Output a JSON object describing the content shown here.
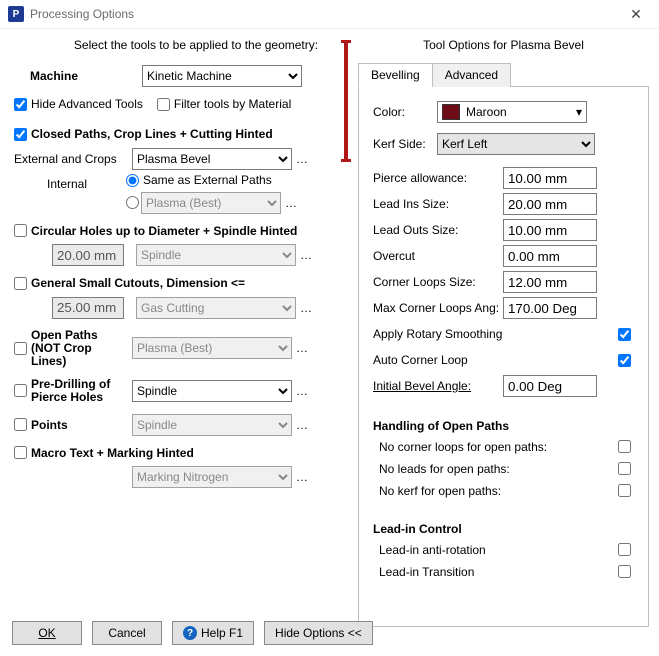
{
  "title": "Processing Options",
  "instruction": "Select the tools to be applied to the geometry:",
  "machine": {
    "label": "Machine",
    "value": "Kinetic Machine"
  },
  "hide_advanced": {
    "label": "Hide Advanced Tools",
    "checked": true
  },
  "filter_material": {
    "label": "Filter tools by Material",
    "checked": false
  },
  "closed_paths": {
    "label": "Closed Paths,  Crop Lines  +  Cutting Hinted",
    "checked": true
  },
  "external": {
    "label": "External and Crops",
    "value": "Plasma Bevel"
  },
  "internal": {
    "label": "Internal",
    "same_label": "Same as External Paths",
    "value": "Plasma (Best)",
    "mode": "same"
  },
  "circular": {
    "label": "Circular Holes up to Diameter   +  Spindle Hinted",
    "checked": false,
    "dim": "20.00 mm",
    "tool": "Spindle"
  },
  "small_cut": {
    "label": "General Small Cutouts, Dimension <=",
    "checked": false,
    "dim": "25.00 mm",
    "tool": "Gas Cutting"
  },
  "open_paths": {
    "label": "Open Paths (NOT Crop Lines)",
    "checked": false,
    "tool": "Plasma (Best)"
  },
  "predrill": {
    "label": "Pre-Drilling of Pierce Holes",
    "checked": false,
    "tool": "Spindle"
  },
  "points": {
    "label": "Points",
    "checked": false,
    "tool": "Spindle"
  },
  "macro": {
    "label": "Macro Text   +  Marking Hinted",
    "checked": false,
    "tool": "Marking Nitrogen"
  },
  "right": {
    "header": "Tool Options for Plasma Bevel",
    "tabs": {
      "bevelling": "Bevelling",
      "advanced": "Advanced"
    },
    "color": {
      "label": "Color:",
      "name": "Maroon",
      "hex": "#6e0b14"
    },
    "kerf": {
      "label": "Kerf Side:",
      "value": "Kerf Left"
    },
    "pierce": {
      "label": "Pierce allowance:",
      "value": "10.00 mm"
    },
    "leadin": {
      "label": "Lead Ins Size:",
      "value": "20.00 mm"
    },
    "leadout": {
      "label": "Lead Outs Size:",
      "value": "10.00 mm"
    },
    "overcut": {
      "label": "Overcut",
      "value": "0.00 mm"
    },
    "corner": {
      "label": "Corner Loops Size:",
      "value": "12.00 mm"
    },
    "maxcorner": {
      "label": "Max Corner Loops Ang:",
      "value": "170.00 Deg"
    },
    "rotary": {
      "label": "Apply Rotary Smoothing",
      "checked": true
    },
    "autocorner": {
      "label": "Auto Corner Loop",
      "checked": true
    },
    "initang": {
      "label": "Initial Bevel Angle:",
      "value": "0.00 Deg"
    },
    "open_hdr": "Handling of Open Paths",
    "no_corner": {
      "label": "No corner loops for open paths:",
      "checked": false
    },
    "no_leads": {
      "label": "No leads for open paths:",
      "checked": false
    },
    "no_kerf": {
      "label": "No kerf for open paths:",
      "checked": false
    },
    "leadctl_hdr": "Lead-in Control",
    "antirot": {
      "label": "Lead-in anti-rotation",
      "checked": false
    },
    "trans": {
      "label": "Lead-in Transition",
      "checked": false
    }
  },
  "footer": {
    "ok": "OK",
    "cancel": "Cancel",
    "help": "Help F1",
    "hide": "Hide Options <<"
  }
}
